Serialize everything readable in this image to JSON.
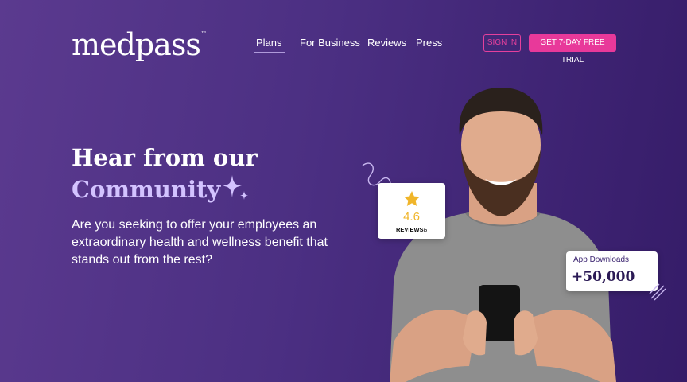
{
  "brand": {
    "logo_text": "medpass",
    "trademark": "™"
  },
  "nav": {
    "items": [
      {
        "label": "Plans",
        "active": true
      },
      {
        "label": "For Business",
        "active": false
      },
      {
        "label": "Reviews",
        "active": false
      },
      {
        "label": "Press",
        "active": false
      }
    ],
    "signin_label": "SIGN IN",
    "trial_label": "GET 7-DAY FREE TRIAL"
  },
  "hero": {
    "headline_line1": "Hear from our",
    "headline_line2": "Community",
    "subtext": "Are you seeking to offer your employees an extraordinary health and wellness benefit that stands out from the rest?"
  },
  "rating_card": {
    "score": "4.6",
    "brand": "REVIEWS",
    "brand_suffix": "io"
  },
  "downloads_card": {
    "label": "App Downloads",
    "value": "+50,000"
  },
  "colors": {
    "accent_pink": "#e8399a",
    "accent_lavender": "#d3c3ff",
    "star_yellow": "#f0b52a",
    "background": "#4b2f82"
  },
  "icons": [
    "sparkle-icon",
    "star-icon",
    "squiggle-decoration",
    "dashes-decoration"
  ]
}
